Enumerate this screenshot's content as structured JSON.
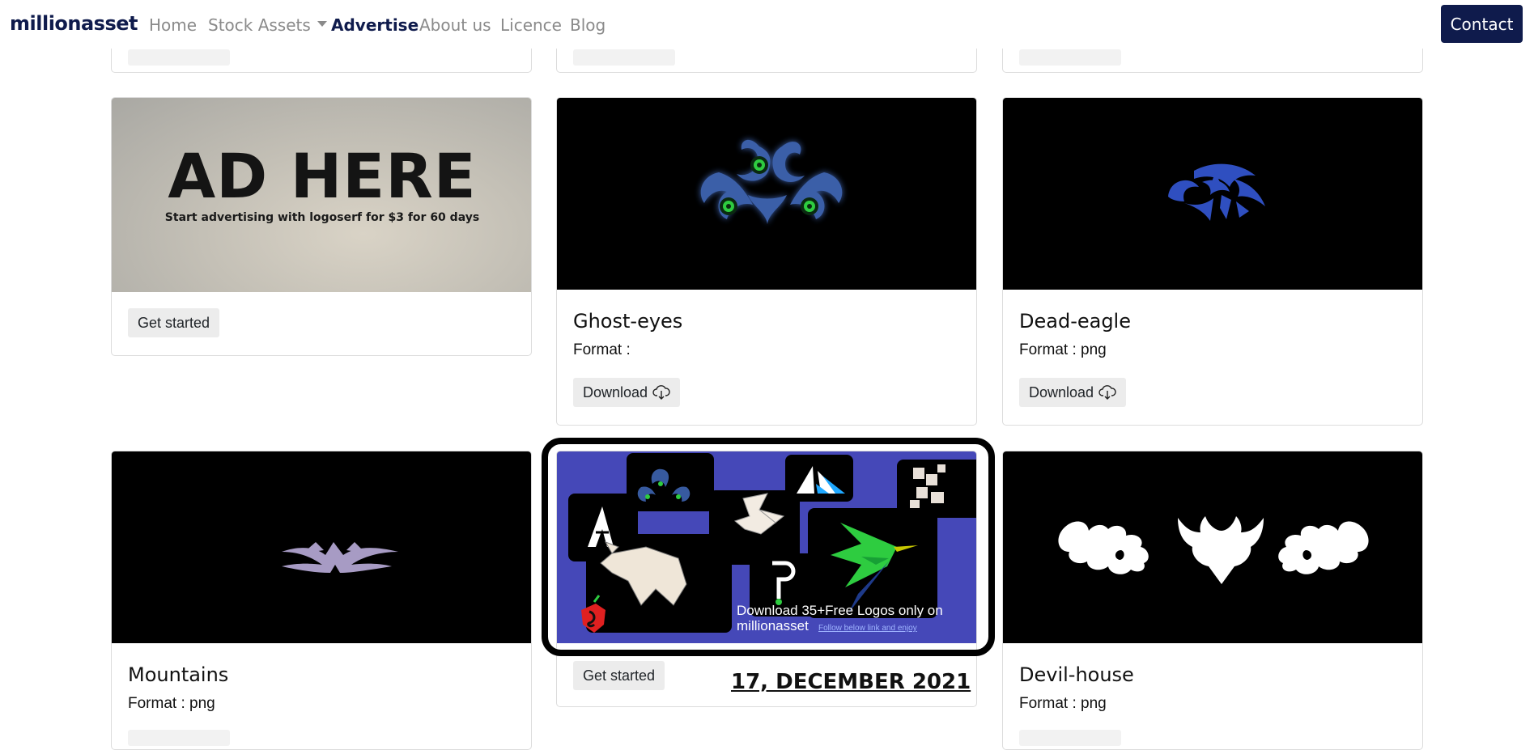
{
  "nav": {
    "brand": "millionasset",
    "links": [
      "Home",
      "Stock Assets",
      "Advertise",
      "About us",
      "Licence",
      "Blog"
    ],
    "active": "Advertise",
    "contact_label": "Contact"
  },
  "ad_card": {
    "headline": "AD HERE",
    "subline": "Start advertising with logoserf for $3 for 60 days",
    "button": "Get started"
  },
  "cards": [
    {
      "title": "Ghost-eyes",
      "format": "Format :",
      "button": "Download"
    },
    {
      "title": "Dead-eagle",
      "format": "Format : png",
      "button": "Download"
    },
    {
      "title": "Mountains",
      "format": "Format : png"
    },
    {
      "title": "Devil-house",
      "format": "Format : png"
    }
  ],
  "promo_card": {
    "headline_line1": "Download 35+Free Logos only on",
    "headline_line2": "millionasset",
    "link_text": "Follow below link and enjoy",
    "button": "Get started"
  },
  "annotation": {
    "date": "17, DECEMBER 2021"
  },
  "colors": {
    "brand": "#0f1b4c",
    "promo_bg": "#4548b8",
    "logo_blue": "#3a5fa8",
    "logo_green": "#2ecc40"
  }
}
